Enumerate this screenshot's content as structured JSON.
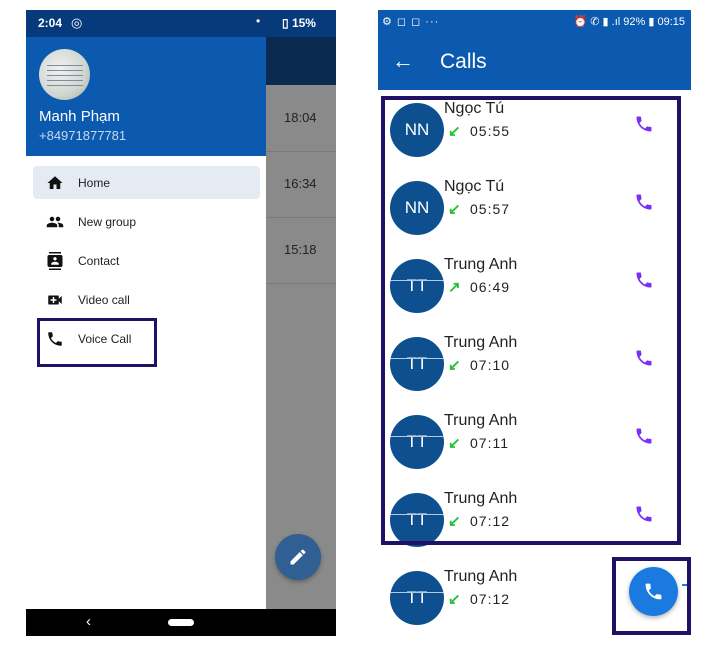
{
  "left_screen": {
    "status_bar": {
      "time": "2:04",
      "dot": "•",
      "battery": "15%"
    },
    "drawer": {
      "user_name": "Manh Phạm",
      "user_phone": "+84971877781",
      "menu": [
        {
          "label": "Home",
          "icon": "home-icon",
          "active": true
        },
        {
          "label": "New group",
          "icon": "group-icon",
          "active": false
        },
        {
          "label": "Contact",
          "icon": "contact-icon",
          "active": false
        },
        {
          "label": "Video call",
          "icon": "video-call-icon",
          "active": false
        },
        {
          "label": "Voice Call",
          "icon": "phone-icon",
          "active": false
        }
      ]
    },
    "background_list_times": [
      "18:04",
      "16:34",
      "15:18"
    ],
    "nav": {
      "back": "‹"
    }
  },
  "right_screen": {
    "status_bar": {
      "left": "⚙ ◻ ◻ ···",
      "right": "⏰ ✆ ▮ .ıl 92% ▮ 09:15"
    },
    "header": {
      "back": "←",
      "title": "Calls"
    },
    "calls": [
      {
        "initials": "NN",
        "name": "Ngọc Tú",
        "direction": "incoming",
        "direction_glyph": "↙",
        "time": "05:55"
      },
      {
        "initials": "NN",
        "name": "Ngọc Tú",
        "direction": "incoming",
        "direction_glyph": "↙",
        "time": "05:57"
      },
      {
        "initials": "TT",
        "name": "Trung Anh",
        "direction": "outgoing",
        "direction_glyph": "↗",
        "time": "06:49"
      },
      {
        "initials": "TT",
        "name": "Trung Anh",
        "direction": "incoming",
        "direction_glyph": "↙",
        "time": "07:10"
      },
      {
        "initials": "TT",
        "name": "Trung Anh",
        "direction": "incoming",
        "direction_glyph": "↙",
        "time": "07:11"
      },
      {
        "initials": "TT",
        "name": "Trung Anh",
        "direction": "incoming",
        "direction_glyph": "↙",
        "time": "07:12"
      },
      {
        "initials": "TT",
        "name": "Trung Anh",
        "direction": "incoming",
        "direction_glyph": "↙",
        "time": "07:12"
      }
    ]
  },
  "colors": {
    "primary": "#0b5ab0",
    "highlight_border": "#1f1266",
    "call_icon": "#7b2ff7",
    "incoming_arrow": "#27c23b",
    "fab": "#1a7ae0"
  }
}
